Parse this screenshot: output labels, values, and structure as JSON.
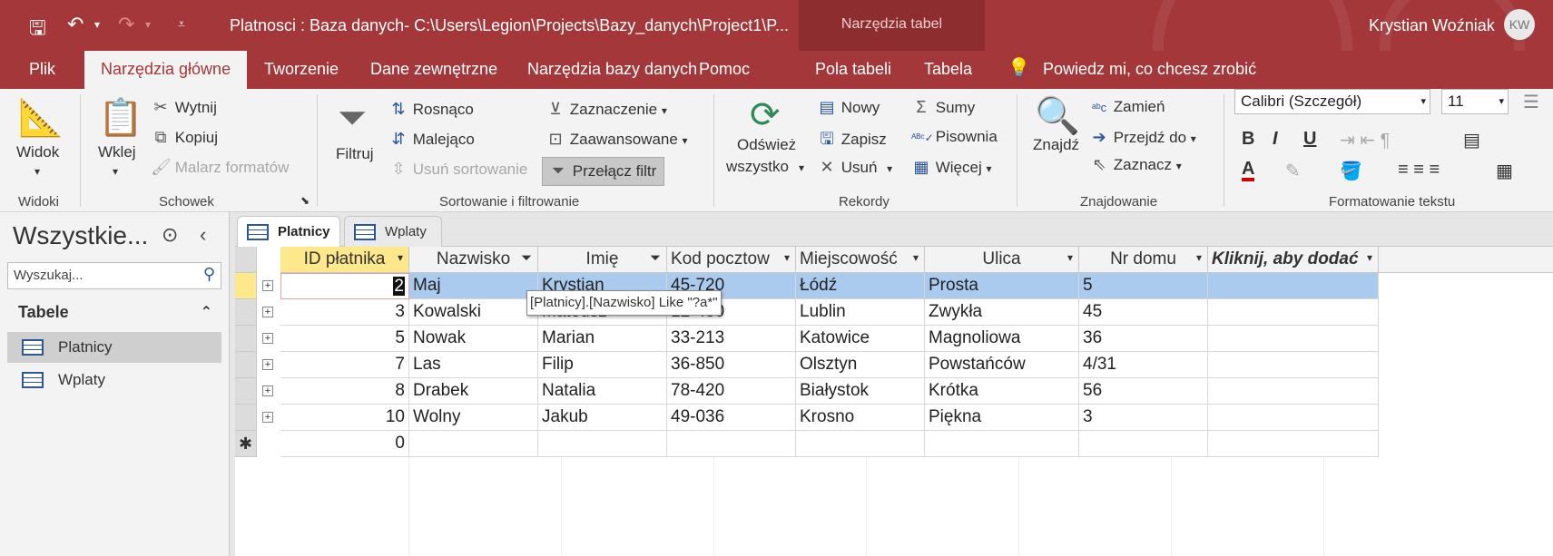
{
  "window": {
    "title": "Platnosci : Baza danych- C:\\Users\\Legion\\Projects\\Bazy_danych\\Project1\\P...",
    "context_tab_group": "Narzędzia tabel",
    "user_name": "Krystian Woźniak",
    "user_initials": "KW",
    "quick_access": {
      "save_icon": "save-icon",
      "undo_icon": "undo-icon",
      "redo_icon": "redo-icon"
    }
  },
  "menu": {
    "tabs": [
      "Plik",
      "Narzędzia główne",
      "Tworzenie",
      "Dane zewnętrzne",
      "Narzędzia bazy danych",
      "Pomoc",
      "Pola tabeli",
      "Tabela"
    ],
    "active_tab": "Narzędzia główne",
    "tell_me": "Powiedz mi, co chcesz zrobić"
  },
  "ribbon": {
    "views": {
      "view_label": "Widok",
      "group": "Widoki"
    },
    "clipboard": {
      "paste": "Wklej",
      "cut": "Wytnij",
      "copy": "Kopiuj",
      "format_painter": "Malarz formatów",
      "group": "Schowek"
    },
    "sort_filter": {
      "filter": "Filtruj",
      "ascending": "Rosnąco",
      "descending": "Malejąco",
      "remove_sort": "Usuń sortowanie",
      "selection": "Zaznaczenie",
      "advanced": "Zaawansowane",
      "toggle_filter": "Przełącz filtr",
      "group": "Sortowanie i filtrowanie"
    },
    "records": {
      "refresh_line1": "Odśwież",
      "refresh_line2": "wszystko",
      "new": "Nowy",
      "save": "Zapisz",
      "delete": "Usuń",
      "totals": "Sumy",
      "spelling": "Pisownia",
      "more": "Więcej",
      "group": "Rekordy"
    },
    "find": {
      "find": "Znajdź",
      "replace": "Zamień",
      "goto": "Przejdź do",
      "select": "Zaznacz",
      "group": "Znajdowanie"
    },
    "text_format": {
      "font": "Calibri (Szczegół)",
      "size": "11",
      "group": "Formatowanie tekstu",
      "font_color": "#d00000"
    }
  },
  "nav": {
    "title": "Wszystkie...",
    "search_placeholder": "Wyszukaj...",
    "section": "Tabele",
    "items": [
      "Platnicy",
      "Wplaty"
    ],
    "selected": "Platnicy"
  },
  "doc_tabs": [
    "Platnicy",
    "Wplaty"
  ],
  "active_doc_tab": "Platnicy",
  "table": {
    "columns": [
      "ID płatnika",
      "Nazwisko",
      "Imię",
      "Kod pocztow",
      "Miejscowość",
      "Ulica",
      "Nr domu",
      "Kliknij, aby dodać"
    ],
    "rows": [
      [
        "2",
        "Maj",
        "Krystian",
        "45-720",
        "Łódź",
        "Prosta",
        "5"
      ],
      [
        "3",
        "Kowalski",
        "Mateusz",
        "12-430",
        "Lublin",
        "Zwykła",
        "45"
      ],
      [
        "5",
        "Nowak",
        "Marian",
        "33-213",
        "Katowice",
        "Magnoliowa",
        "36"
      ],
      [
        "7",
        "Las",
        "Filip",
        "36-850",
        "Olsztyn",
        "Powstańców",
        "4/31"
      ],
      [
        "8",
        "Drabek",
        "Natalia",
        "78-420",
        "Białystok",
        "Krótka",
        "56"
      ],
      [
        "10",
        "Wolny",
        "Jakub",
        "49-036",
        "Krosno",
        "Piękna",
        "3"
      ]
    ],
    "new_row_id": "0",
    "new_row_marker": "✱",
    "selected_row": 0,
    "filtered_columns": [
      "Nazwisko",
      "Imię"
    ],
    "sorted_column": "ID płatnika"
  },
  "tooltip": "[Platnicy].[Nazwisko] Like \"?a*\"",
  "colors": {
    "accent": "#a4373a",
    "selection": "#aacaee",
    "sort_highlight": "#fde88b"
  }
}
